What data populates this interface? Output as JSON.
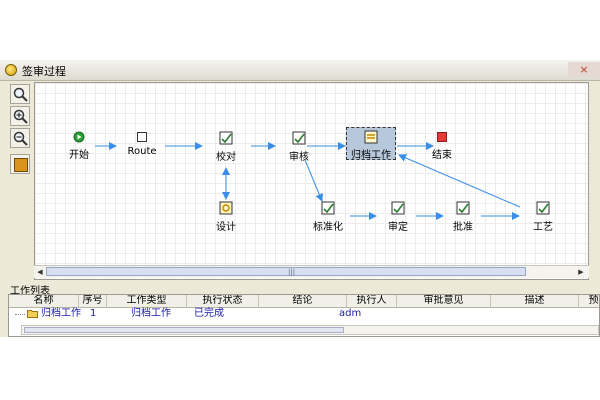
{
  "window": {
    "title": "签审过程",
    "close_label": "×"
  },
  "toolbar": {
    "tools": [
      {
        "name": "zoom-icon"
      },
      {
        "name": "zoom-in-icon"
      },
      {
        "name": "zoom-out-icon"
      },
      {
        "name": "color-picker-icon",
        "color": "#d9941c"
      }
    ]
  },
  "workflow": {
    "nodes": {
      "start": {
        "label": "开始",
        "icon": "start-icon"
      },
      "route": {
        "label": "Route",
        "icon": "route-icon"
      },
      "proofread": {
        "label": "校对",
        "icon": "task-icon"
      },
      "review": {
        "label": "审核",
        "icon": "task-icon"
      },
      "archive": {
        "label": "归档工作",
        "icon": "archive-icon"
      },
      "end": {
        "label": "结束",
        "icon": "end-icon"
      },
      "design": {
        "label": "设计",
        "icon": "design-icon"
      },
      "standardize": {
        "label": "标准化",
        "icon": "task-icon"
      },
      "examine": {
        "label": "审定",
        "icon": "task-icon"
      },
      "approve": {
        "label": "批准",
        "icon": "task-icon"
      },
      "process": {
        "label": "工艺",
        "icon": "task-icon"
      }
    },
    "edge_color": "#3a8ee6",
    "selected_node": "archive"
  },
  "work_list": {
    "title": "工作列表",
    "columns": [
      "名称",
      "序号",
      "工作类型",
      "执行状态",
      "结论",
      "执行人",
      "审批意见",
      "描述",
      "预期"
    ],
    "rows": [
      {
        "name": "归档工作",
        "seq": "1",
        "type": "归档工作",
        "status": "已完成",
        "conclusion": "",
        "executor": "adm",
        "opinion": "",
        "desc": "",
        "expected": ""
      }
    ]
  }
}
